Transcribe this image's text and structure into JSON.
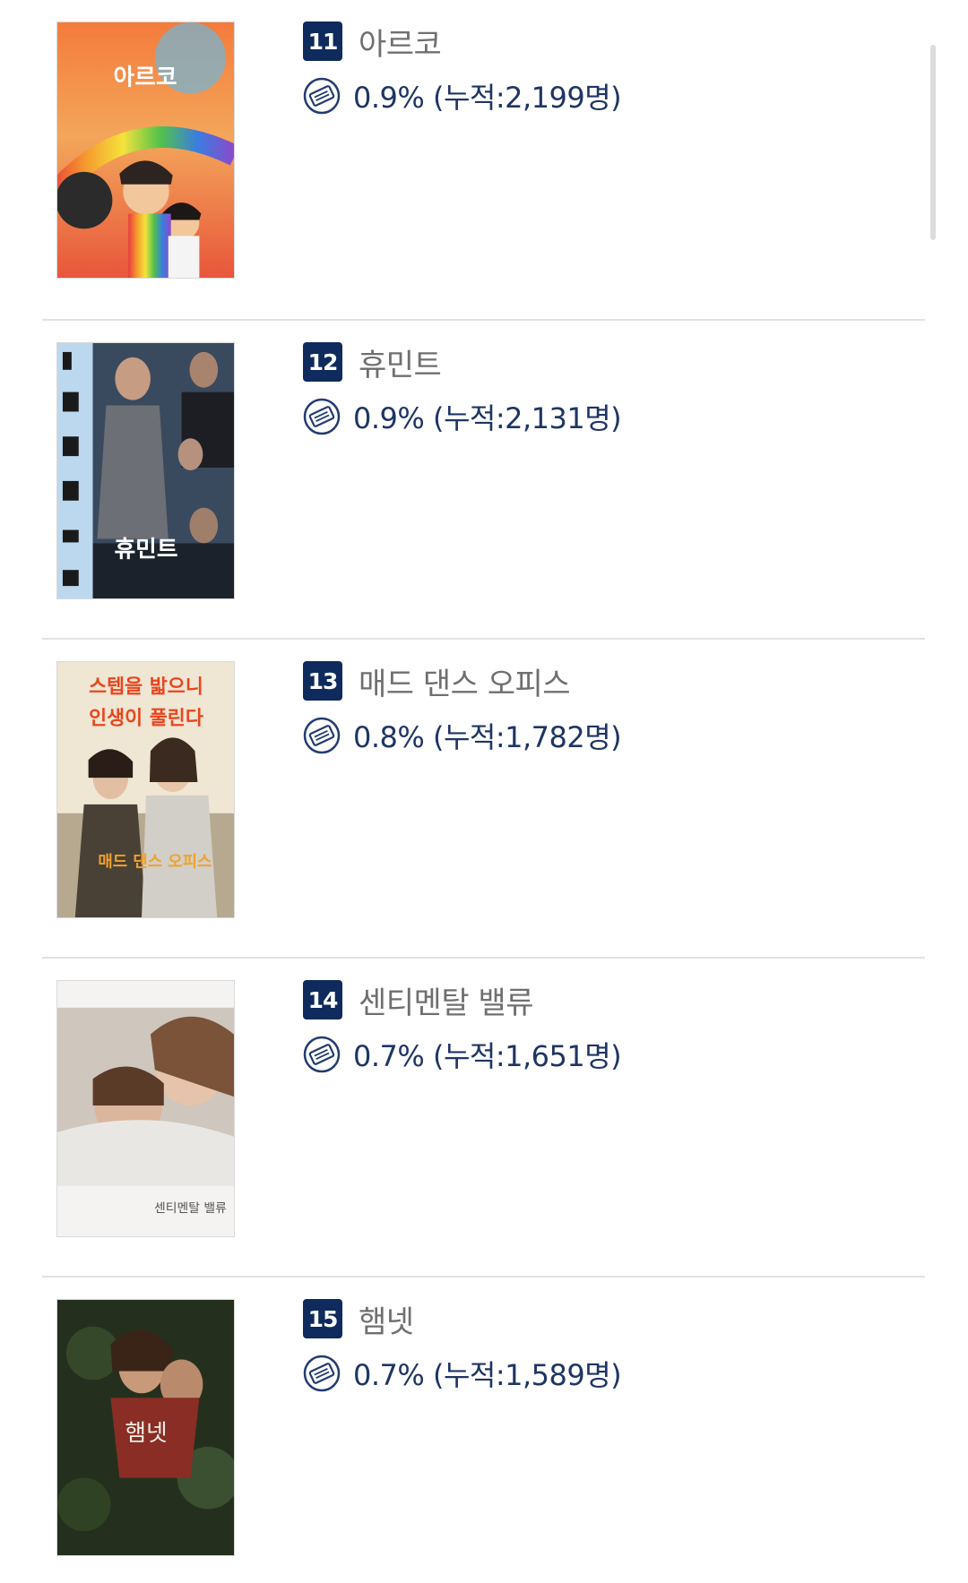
{
  "colors": {
    "rank_badge": "#0f2a5c",
    "title_text": "#6f6f6f",
    "stat_text": "#1f3564",
    "divider": "#e2e2e2"
  },
  "ranking": {
    "items": [
      {
        "rank": "11",
        "title": "아르코",
        "stat": "0.9% (누적:2,199명)",
        "poster_icon": "movie-poster"
      },
      {
        "rank": "12",
        "title": "휴민트",
        "stat": "0.9% (누적:2,131명)",
        "poster_icon": "movie-poster"
      },
      {
        "rank": "13",
        "title": "매드 댄스 오피스",
        "stat": "0.8% (누적:1,782명)",
        "poster_icon": "movie-poster"
      },
      {
        "rank": "14",
        "title": "센티멘탈 밸류",
        "stat": "0.7% (누적:1,651명)",
        "poster_icon": "movie-poster"
      },
      {
        "rank": "15",
        "title": "햄넷",
        "stat": "0.7% (누적:1,589명)",
        "poster_icon": "movie-poster"
      }
    ]
  },
  "icons": {
    "stat_icon": "ticket-icon"
  },
  "posters": {
    "p1_text": "아르코",
    "p2_text": "휴민트",
    "p3_line1": "스텝을 밟으니",
    "p3_line2": "인생이 풀린다",
    "p3_text": "매드 댄스 오피스",
    "p4_text": "센티멘탈 밸류",
    "p5_text": "햄넷"
  }
}
